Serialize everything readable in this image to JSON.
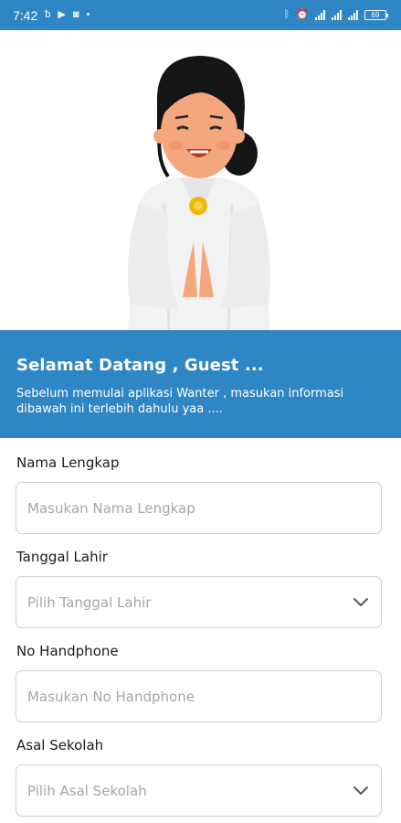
{
  "status_bar": {
    "time": "7:42",
    "left_icons": [
      "notification-b-icon",
      "play-icon",
      "game-icon",
      "dot-icon"
    ],
    "right_icons": [
      "bluetooth-icon",
      "alarm-icon",
      "wifi-call-icon",
      "signal-icon",
      "signal-4g-icon",
      "battery-icon"
    ],
    "battery_level": "69"
  },
  "hero": {
    "illustration": "woman-greeting-namaste-illustration"
  },
  "welcome": {
    "title": "Selamat Datang , Guest ...",
    "message": "Sebelum memulai aplikasi Wanter , masukan informasi dibawah ini terlebih dahulu yaa ...."
  },
  "form": {
    "full_name": {
      "label": "Nama Lengkap",
      "placeholder": "Masukan Nama Lengkap",
      "value": ""
    },
    "birth_date": {
      "label": "Tanggal Lahir",
      "placeholder": "Pilih Tanggal Lahir",
      "icon": "chevron-down-icon"
    },
    "phone": {
      "label": "No Handphone",
      "placeholder": "Masukan No Handphone",
      "value": ""
    },
    "school": {
      "label": "Asal Sekolah",
      "placeholder": "Pilih Asal Sekolah",
      "icon": "chevron-down-icon"
    }
  },
  "colors": {
    "primary": "#2f86c4",
    "field_border": "#cfcfcf",
    "placeholder": "#a6a6a6"
  }
}
